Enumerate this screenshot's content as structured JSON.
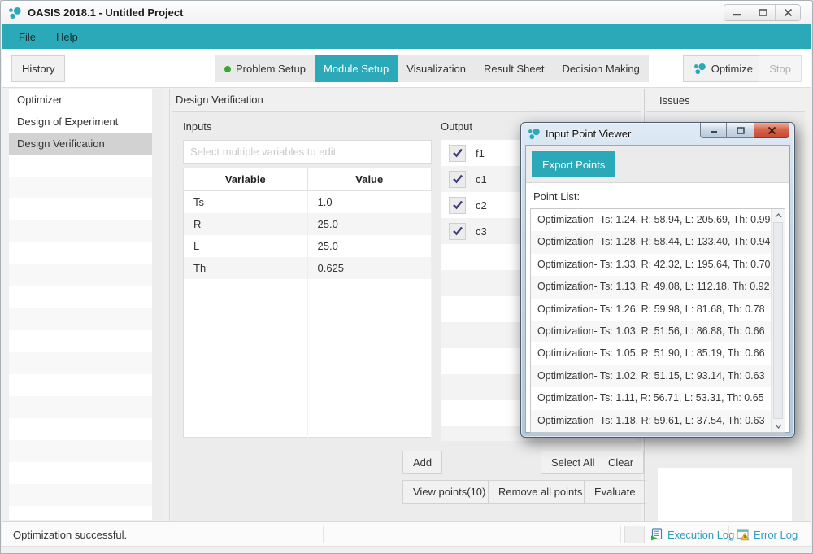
{
  "colors": {
    "accent_teal": "#2BA9B8",
    "status_dot_green": "#3aa52f",
    "close_button_red": "#d9644a",
    "checkmark_navy": "#3d3c78",
    "log_link_teal": "#2f9dbe",
    "selected_row_gray": "#d2d2d2"
  },
  "window": {
    "title": "OASIS 2018.1 - Untitled Project"
  },
  "menu_bar": {
    "items": [
      {
        "label": "File"
      },
      {
        "label": "Help"
      }
    ]
  },
  "toolbar": {
    "history_label": "History",
    "tabs": [
      {
        "label": "Problem Setup",
        "active": false,
        "has_status_dot": true
      },
      {
        "label": "Module Setup",
        "active": true,
        "has_status_dot": false
      },
      {
        "label": "Visualization",
        "active": false,
        "has_status_dot": false
      },
      {
        "label": "Result Sheet",
        "active": false,
        "has_status_dot": false
      },
      {
        "label": "Decision Making",
        "active": false,
        "has_status_dot": false
      }
    ],
    "optimize_label": "Optimize",
    "stop_label": "Stop"
  },
  "sidebar": {
    "items": [
      {
        "label": "Optimizer",
        "selected": false
      },
      {
        "label": "Design of Experiment",
        "selected": false
      },
      {
        "label": "Design Verification",
        "selected": true
      }
    ]
  },
  "main": {
    "title": "Design Verification",
    "inputs_label": "Inputs",
    "multi_edit_placeholder": "Select multiple variables to edit",
    "table": {
      "columns": [
        "Variable",
        "Value"
      ],
      "rows": [
        {
          "variable": "Ts",
          "value": "1.0"
        },
        {
          "variable": "R",
          "value": "25.0"
        },
        {
          "variable": "L",
          "value": "25.0"
        },
        {
          "variable": "Th",
          "value": "0.625"
        }
      ]
    },
    "output_label": "Output",
    "outputs": [
      {
        "label": "f1",
        "checked": true
      },
      {
        "label": "c1",
        "checked": true
      },
      {
        "label": "c2",
        "checked": true
      },
      {
        "label": "c3",
        "checked": true
      }
    ],
    "buttons": {
      "add": "Add",
      "select_all": "Select All",
      "clear": "Clear",
      "view_points": "View points(10)",
      "remove_all": "Remove all points",
      "evaluate": "Evaluate"
    }
  },
  "issues_panel": {
    "title": "Issues"
  },
  "dialog": {
    "title": "Input Point Viewer",
    "export_points_label": "Export Points",
    "point_list_label": "Point List:",
    "points": [
      "Optimization- Ts: 1.24, R: 58.94, L: 205.69, Th: 0.99",
      "Optimization- Ts: 1.28, R: 58.44, L: 133.40, Th: 0.94",
      "Optimization- Ts: 1.33, R: 42.32, L: 195.64, Th: 0.70",
      "Optimization- Ts: 1.13, R: 49.08, L: 112.18, Th: 0.92",
      "Optimization- Ts: 1.26, R: 59.98, L: 81.68, Th: 0.78",
      "Optimization- Ts: 1.03, R: 51.56, L: 86.88, Th: 0.66",
      "Optimization- Ts: 1.05, R: 51.90, L: 85.19, Th: 0.66",
      "Optimization- Ts: 1.02, R: 51.15, L: 93.14, Th: 0.63",
      "Optimization- Ts: 1.11, R: 56.71, L: 53.31, Th: 0.65",
      "Optimization- Ts: 1.18, R: 59.61, L: 37.54, Th: 0.63"
    ]
  },
  "status_bar": {
    "message": "Optimization successful.",
    "execution_log_label": "Execution Log",
    "error_log_label": "Error Log"
  }
}
